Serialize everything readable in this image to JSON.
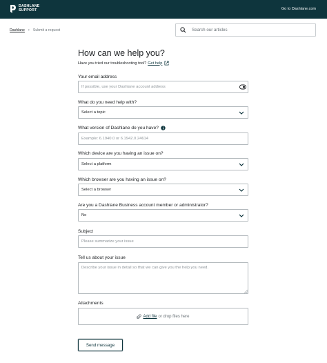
{
  "header": {
    "logo_line1": "DASHLANE",
    "logo_line2": "SUPPORT",
    "goto_link": "Go to Dashlane.com"
  },
  "breadcrumb": {
    "home": "Dashlane",
    "current": "Submit a request"
  },
  "search": {
    "placeholder": "Search our articles"
  },
  "form": {
    "title": "How can we help you?",
    "subtitle": "Have you tried our troubleshooting tool?",
    "subtitle_link": "Get help",
    "email": {
      "label": "Your email address",
      "placeholder": "If possible, use your Dashlane account address"
    },
    "topic": {
      "label": "What do you need help with?",
      "value": "Select a topic"
    },
    "version": {
      "label": "What version of Dashlane do you have?",
      "placeholder": "Example: 6.1940.0 or 6.1942.0.24614"
    },
    "device": {
      "label": "Which device are you having an issue on?",
      "value": "Select a platform"
    },
    "browser": {
      "label": "Which browser are you having an issue on?",
      "value": "Select a browser"
    },
    "business": {
      "label": "Are you a Dashlane Business account member or administrator?",
      "value": "No"
    },
    "subject": {
      "label": "Subject",
      "placeholder": "Please summarize your issue"
    },
    "description": {
      "label": "Tell us about your issue",
      "placeholder": "Describe your issue in detail so that we can give you the help you need."
    },
    "attachments": {
      "label": "Attachments",
      "add_file": "Add file",
      "drop_text": "or drop files here"
    },
    "submit_label": "Send message"
  },
  "colors": {
    "header_bg": "#0e353d",
    "accent": "#0e353d",
    "border": "#b3b9bd"
  }
}
